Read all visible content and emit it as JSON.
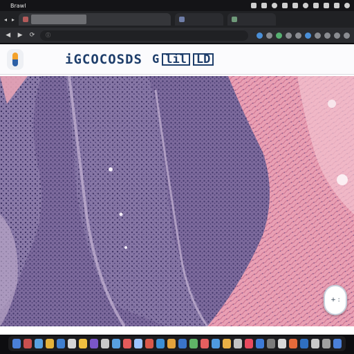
{
  "menubar": {
    "apple_glyph": "",
    "items": [
      "Brawl",
      "",
      "",
      "",
      "",
      "",
      "",
      "",
      ""
    ]
  },
  "browser": {
    "nav_back": "◀",
    "nav_forward": "▶",
    "reload": "⟳",
    "omnibox_security_glyph": "ⓘ"
  },
  "site": {
    "title_main": "iGCOCOSDS",
    "title_part_a": "G",
    "title_part_b": "lil",
    "title_part_c": "LD"
  },
  "zoom_widget": {
    "label": "+ :"
  },
  "dock": {
    "icon_colors": [
      "#4a7fd8",
      "#c94f4f",
      "#58a0e0",
      "#e4b23a",
      "#3f7fd0",
      "#d6d6d6",
      "#f0c040",
      "#7a56c8",
      "#c9c9c9",
      "#58a0e0",
      "#e35b5b",
      "#9cc4ff",
      "#d9584a",
      "#3c8fd6",
      "#e3a23c",
      "#3a74c9",
      "#5fb367",
      "#e45f5f",
      "#4f9be0",
      "#eab045",
      "#c3c3c3",
      "#e84a5f",
      "#3d7ad6",
      "#7b7b7b",
      "#d8d8d8",
      "#e46a3a",
      "#2f6fc0",
      "#c9c9c9",
      "#a0a0a0",
      "#4a7fd8"
    ]
  }
}
